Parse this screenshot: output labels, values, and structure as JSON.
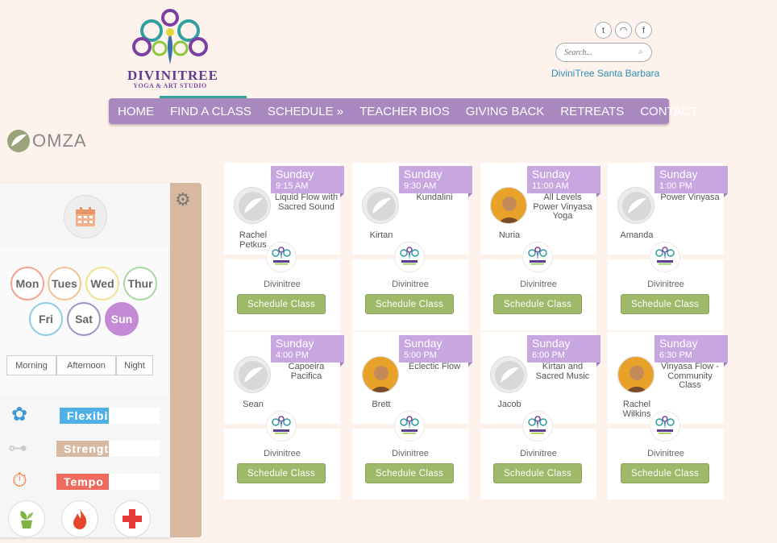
{
  "header": {
    "logo_name": "DIVINITREE",
    "logo_sub": "YOGA & ART STUDIO",
    "social": [
      {
        "icon": "twitter-icon",
        "glyph": "t"
      },
      {
        "icon": "rss-icon",
        "glyph": "◠"
      },
      {
        "icon": "facebook-icon",
        "glyph": "f"
      }
    ],
    "search_placeholder": "Search...",
    "location": "DiviniTree Santa Barbara"
  },
  "nav": [
    "HOME",
    "FIND A CLASS",
    "SCHEDULE »",
    "TEACHER BIOS",
    "GIVING BACK",
    "RETREATS",
    "CONTACT"
  ],
  "brand": {
    "name": "OMZA"
  },
  "filters": {
    "days": [
      {
        "label": "Mon",
        "color": "#f2a48e"
      },
      {
        "label": "Tues",
        "color": "#f6c095"
      },
      {
        "label": "Wed",
        "color": "#f0e28f"
      },
      {
        "label": "Thur",
        "color": "#a6d8a0"
      },
      {
        "label": "Fri",
        "color": "#8fcbe6"
      },
      {
        "label": "Sat",
        "color": "#9b95c9"
      },
      {
        "label": "Sun",
        "color": "#c48ad6",
        "selected": true
      }
    ],
    "times": [
      "Morning",
      "Afternoon",
      "Night"
    ],
    "metrics": [
      {
        "label": "Flexibility",
        "color": "#4fb0e8",
        "level": 0.49
      },
      {
        "label": "Strength",
        "color": "#d7b8a0",
        "level": 0.51
      },
      {
        "label": "Tempo",
        "color": "#f06a5e",
        "level": 0.51
      }
    ]
  },
  "classes": [
    {
      "day": "Sunday",
      "time": "9:15 AM",
      "name": "Liquid Flow with Sacred Sound",
      "teacher": "Rachel Petkus",
      "studio": "Divinitree",
      "button": "Schedule Class",
      "photo": false
    },
    {
      "day": "Sunday",
      "time": "9:30 AM",
      "name": "Kundalini",
      "teacher": "Kirtan",
      "studio": "Divinitree",
      "button": "Schedule Class",
      "photo": false
    },
    {
      "day": "Sunday",
      "time": "11:00 AM",
      "name": "All Levels Power Vinyasa Yoga",
      "teacher": "Nuria",
      "studio": "Divinitree",
      "button": "Schedule Class",
      "photo": true
    },
    {
      "day": "Sunday",
      "time": "1:00 PM",
      "name": "Power Vinyasa",
      "teacher": "Amanda",
      "studio": "Divinitree",
      "button": "Schedule Class",
      "photo": false
    },
    {
      "day": "Sunday",
      "time": "4:00 PM",
      "name": "Capoeira Pacifica",
      "teacher": "Sean",
      "studio": "Divinitree",
      "button": "Schedule Class",
      "photo": false
    },
    {
      "day": "Sunday",
      "time": "5:00 PM",
      "name": "Eclectic Flow",
      "teacher": "Brett",
      "studio": "Divinitree",
      "button": "Schedule Class",
      "photo": true
    },
    {
      "day": "Sunday",
      "time": "6:00 PM",
      "name": "Kirtan and Sacred Music",
      "teacher": "Jacob",
      "studio": "Divinitree",
      "button": "Schedule Class",
      "photo": false
    },
    {
      "day": "Sunday",
      "time": "6:30 PM",
      "name": "Vinyasa Flow - Community Class",
      "teacher": "Rachel Wilkins",
      "studio": "Divinitree",
      "button": "Schedule Class",
      "photo": true
    }
  ]
}
